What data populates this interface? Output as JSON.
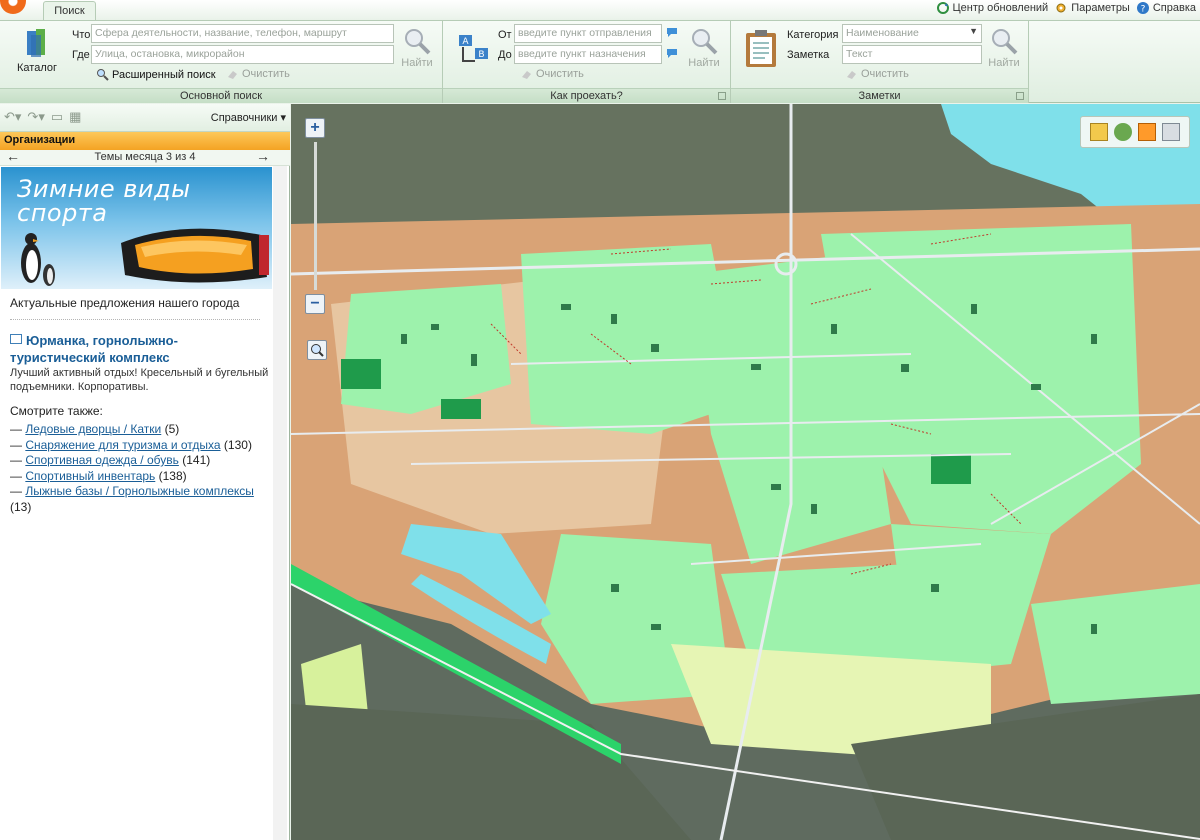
{
  "tabs": {
    "search": "Поиск"
  },
  "top_links": {
    "updates": "Центр обновлений",
    "params": "Параметры",
    "help": "Справка"
  },
  "ribbon": {
    "catalog_label": "Каталог",
    "main_search": {
      "title": "Основной поиск",
      "what_label": "Что",
      "what_placeholder": "Сфера деятельности, название, телефон, маршрут",
      "where_label": "Где",
      "where_placeholder": "Улица, остановка, микрорайон",
      "advanced": "Расширенный поиск",
      "clear": "Очистить",
      "find": "Найти"
    },
    "route": {
      "title": "Как проехать?",
      "from_label": "От",
      "from_placeholder": "введите пункт отправления",
      "to_label": "До",
      "to_placeholder": "введите пункт назначения",
      "clear": "Очистить",
      "find": "Найти"
    },
    "notes": {
      "title": "Заметки",
      "category_label": "Категория",
      "category_value": "Наименование",
      "note_label": "Заметка",
      "note_placeholder": "Текст",
      "clear": "Очистить",
      "find": "Найти"
    }
  },
  "left_panel": {
    "directories": "Справочники",
    "organizations": "Организации",
    "month_topics": "Темы месяца 3 из 4",
    "banner_line1": "Зимние виды",
    "banner_line2": "спорта",
    "offers": "Актуальные предложения нашего города",
    "org_title": "Юрманка, горнолыжно-туристический комплекс",
    "org_desc": "Лучший активный отдых! Кресельный и бугельный подъемники. Корпоративы.",
    "see_also": "Смотрите также:",
    "links": [
      {
        "text": "Ледовые дворцы / Катки",
        "count": "(5)"
      },
      {
        "text": "Снаряжение для туризма и отдыха",
        "count": "(130)"
      },
      {
        "text": "Спортивная одежда / обувь",
        "count": "(141)"
      },
      {
        "text": "Спортивный инвентарь",
        "count": "(138)"
      },
      {
        "text": "Лыжные базы / Горнолыжные комплексы",
        "count": "(13)"
      }
    ]
  },
  "colors": {
    "ribbon_bg": "#e3f0e3",
    "org_bar": "#f8b53a",
    "link": "#1a5e97",
    "map_dark": "#5f6b5f",
    "map_sand": "#d9a376",
    "map_green": "#9df2ac",
    "map_water": "#7fe0ea"
  },
  "map_tools": [
    "ruler-icon",
    "layers-icon",
    "note-icon",
    "print-icon"
  ]
}
